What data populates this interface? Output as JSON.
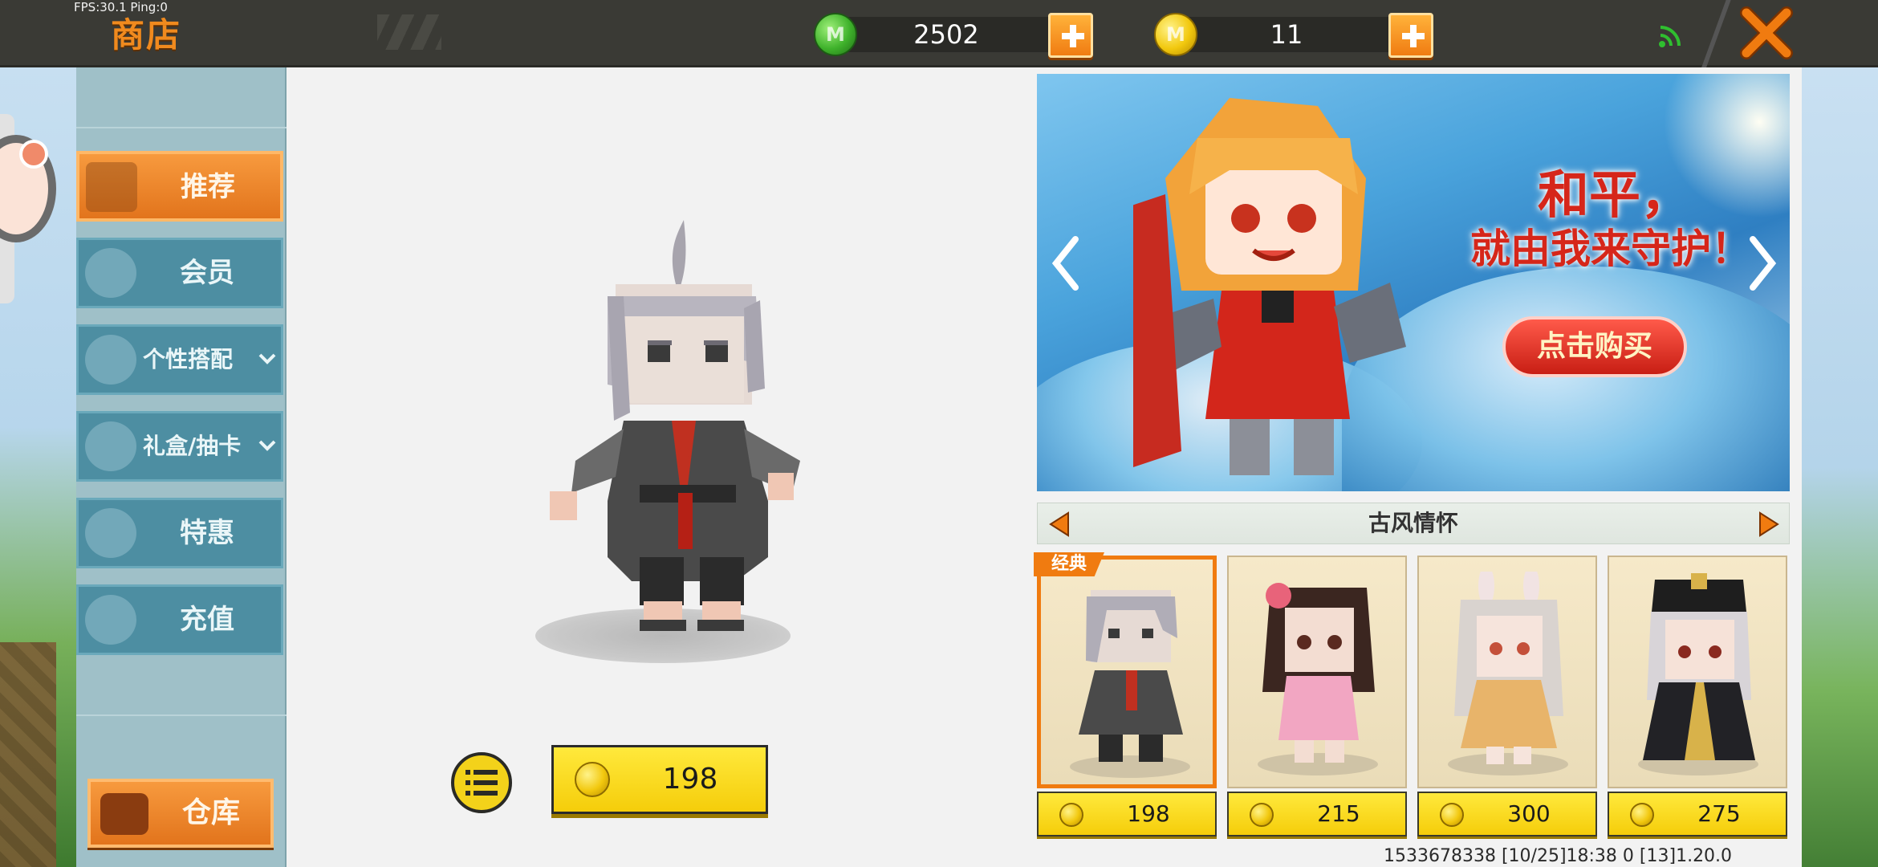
{
  "hud": {
    "fps_text": "FPS:30.1  Ping:0",
    "title": "商店",
    "mini_coins": {
      "value": "2502",
      "icon": "gem-currency-icon"
    },
    "gold_coins": {
      "value": "11",
      "icon": "gold-coin-icon"
    },
    "accent": "#f08a1e"
  },
  "sidebar": {
    "items": [
      {
        "label": "推荐",
        "icon": "thumbs-up-icon",
        "active": true
      },
      {
        "label": "会员",
        "icon": "membership-icon",
        "active": false
      },
      {
        "label": "个性搭配",
        "icon": "trophy-icon",
        "active": false,
        "expandable": true
      },
      {
        "label": "礼盒/抽卡",
        "icon": "gift-disc-icon",
        "active": false,
        "expandable": true
      },
      {
        "label": "特惠",
        "icon": "gift-box-icon",
        "active": false
      },
      {
        "label": "充值",
        "icon": "coin-stack-icon",
        "active": false
      }
    ],
    "warehouse_label": "仓库"
  },
  "preview": {
    "price": "198"
  },
  "banner": {
    "headline1": "和平，",
    "headline2": "就由我来守护！",
    "buy_label": "点击购买"
  },
  "category": {
    "label": "古风情怀"
  },
  "skins": [
    {
      "price": "198",
      "tag": "经典",
      "selected": true
    },
    {
      "price": "215",
      "tag": "",
      "selected": false
    },
    {
      "price": "300",
      "tag": "",
      "selected": false
    },
    {
      "price": "275",
      "tag": "",
      "selected": false
    }
  ],
  "status": {
    "text": "1533678338  [10/25]18:38 0  [13]1.20.0"
  }
}
